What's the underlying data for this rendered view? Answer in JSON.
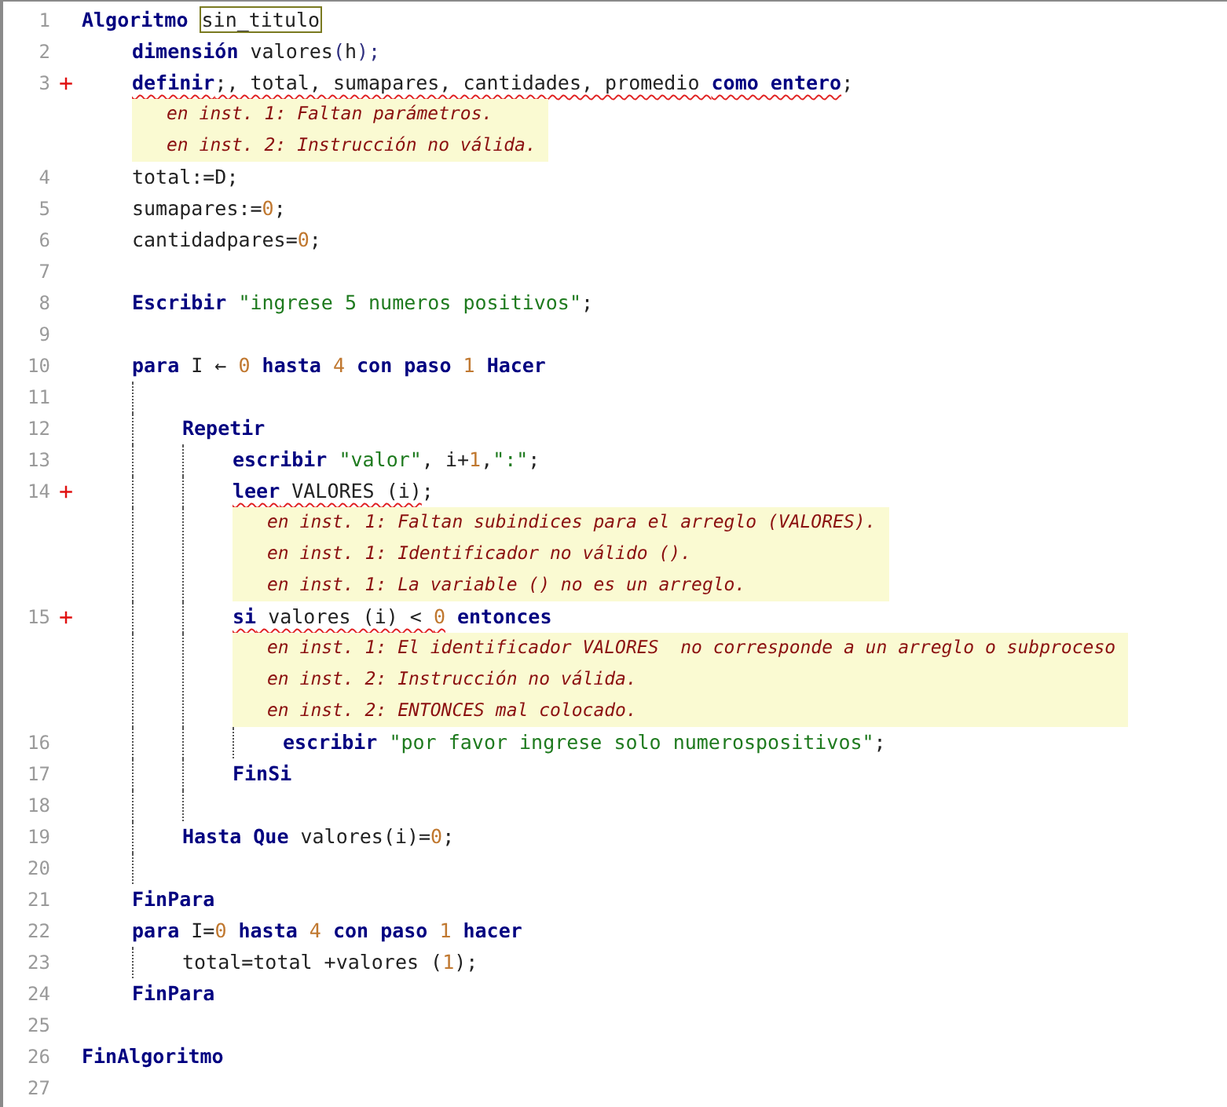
{
  "editor": {
    "lines": [
      {
        "number": "1",
        "tokens": [
          {
            "text": "Algoritmo ",
            "kind": "kw"
          },
          {
            "text": "sin_titulo",
            "kind": "match"
          }
        ],
        "children": [
          {
            "number": "2",
            "tokens": [
              {
                "text": "dimensión",
                "kind": "kw"
              },
              {
                "text": " valores",
                "kind": "id"
              },
              {
                "text": "(",
                "kind": "op"
              },
              {
                "text": "h",
                "kind": "id"
              },
              {
                "text": ");",
                "kind": "op"
              }
            ]
          },
          {
            "number": "3",
            "marker": "+",
            "tokens": [
              {
                "kind": "error",
                "tokens": [
                  {
                    "text": "definir",
                    "kind": "kw"
                  },
                  {
                    "text": ";, total, sumapares, cantidades, promedio ",
                    "kind": "id"
                  },
                  {
                    "text": "como entero",
                    "kind": "kw"
                  }
                ]
              },
              {
                "text": ";",
                "kind": "id"
              }
            ],
            "messages": [
              "en inst. 1: Faltan parámetros.",
              "en inst. 2: Instrucción no válida."
            ]
          },
          {
            "number": "4",
            "tokens": [
              {
                "text": "total:=D;",
                "kind": "id"
              }
            ]
          },
          {
            "number": "5",
            "tokens": [
              {
                "text": "sumapares:=",
                "kind": "id"
              },
              {
                "text": "0",
                "kind": "num"
              },
              {
                "text": ";",
                "kind": "id"
              }
            ]
          },
          {
            "number": "6",
            "tokens": [
              {
                "text": "cantidadpares=",
                "kind": "id"
              },
              {
                "text": "0",
                "kind": "num"
              },
              {
                "text": ";",
                "kind": "id"
              }
            ]
          },
          {
            "number": "7"
          },
          {
            "number": "8",
            "tokens": [
              {
                "text": "Escribir ",
                "kind": "kw"
              },
              {
                "text": "\"ingrese 5 numeros positivos\"",
                "kind": "str"
              },
              {
                "text": ";",
                "kind": "id"
              }
            ]
          },
          {
            "number": "9"
          },
          {
            "number": "10",
            "tokens": [
              {
                "text": "para",
                "kind": "kw"
              },
              {
                "text": " I ← ",
                "kind": "id"
              },
              {
                "text": "0",
                "kind": "num"
              },
              {
                "text": " hasta ",
                "kind": "kw"
              },
              {
                "text": "4",
                "kind": "num"
              },
              {
                "text": " con paso ",
                "kind": "kw"
              },
              {
                "text": "1",
                "kind": "num"
              },
              {
                "text": " Hacer",
                "kind": "kw"
              }
            ],
            "children": [
              {
                "number": "11"
              },
              {
                "number": "12",
                "tokens": [
                  {
                    "text": "Repetir",
                    "kind": "kw"
                  }
                ],
                "children": [
                  {
                    "number": "13",
                    "tokens": [
                      {
                        "text": "escribir ",
                        "kind": "kw"
                      },
                      {
                        "text": "\"valor\"",
                        "kind": "str"
                      },
                      {
                        "text": ", i+",
                        "kind": "id"
                      },
                      {
                        "text": "1",
                        "kind": "num"
                      },
                      {
                        "text": ",",
                        "kind": "id"
                      },
                      {
                        "text": "\":\"",
                        "kind": "str"
                      },
                      {
                        "text": ";",
                        "kind": "id"
                      }
                    ]
                  },
                  {
                    "number": "14",
                    "marker": "+",
                    "tokens": [
                      {
                        "kind": "error",
                        "tokens": [
                          {
                            "text": "leer",
                            "kind": "kw"
                          },
                          {
                            "text": " VALORES (i)",
                            "kind": "id"
                          }
                        ]
                      },
                      {
                        "text": ";",
                        "kind": "id"
                      }
                    ],
                    "messages": [
                      "en inst. 1: Faltan subindices para el arreglo (VALORES).",
                      "en inst. 1: Identificador no válido ().",
                      "en inst. 1: La variable () no es un arreglo."
                    ]
                  },
                  {
                    "number": "15",
                    "marker": "+",
                    "tokens": [
                      {
                        "kind": "error",
                        "tokens": [
                          {
                            "text": "si",
                            "kind": "kw"
                          },
                          {
                            "text": " valores (i) < ",
                            "kind": "id"
                          },
                          {
                            "text": "0",
                            "kind": "num"
                          }
                        ]
                      },
                      {
                        "text": " entonces",
                        "kind": "kw"
                      }
                    ],
                    "messages": [
                      "en inst. 1: El identificador VALORES  no corresponde a un arreglo o subproceso",
                      "en inst. 2: Instrucción no válida.",
                      "en inst. 2: ENTONCES mal colocado."
                    ],
                    "children": [
                      {
                        "number": "16",
                        "tokens": [
                          {
                            "text": "escribir ",
                            "kind": "kw"
                          },
                          {
                            "text": "\"por favor ingrese solo numerospositivos\"",
                            "kind": "str"
                          },
                          {
                            "text": ";",
                            "kind": "id"
                          }
                        ]
                      }
                    ]
                  },
                  {
                    "number": "17",
                    "tokens": [
                      {
                        "text": "FinSi",
                        "kind": "kw"
                      }
                    ]
                  },
                  {
                    "number": "18"
                  }
                ]
              },
              {
                "number": "19",
                "tokens": [
                  {
                    "text": "Hasta Que",
                    "kind": "kw"
                  },
                  {
                    "text": " valores(i)=",
                    "kind": "id"
                  },
                  {
                    "text": "0",
                    "kind": "num"
                  },
                  {
                    "text": ";",
                    "kind": "id"
                  }
                ]
              },
              {
                "number": "20"
              }
            ]
          },
          {
            "number": "21",
            "tokens": [
              {
                "text": "FinPara",
                "kind": "kw"
              }
            ]
          },
          {
            "number": "22",
            "tokens": [
              {
                "text": "para",
                "kind": "kw"
              },
              {
                "text": " I=",
                "kind": "id"
              },
              {
                "text": "0",
                "kind": "num"
              },
              {
                "text": " hasta ",
                "kind": "kw"
              },
              {
                "text": "4",
                "kind": "num"
              },
              {
                "text": " con paso ",
                "kind": "kw"
              },
              {
                "text": "1",
                "kind": "num"
              },
              {
                "text": " hacer",
                "kind": "kw"
              }
            ],
            "children": [
              {
                "number": "23",
                "tokens": [
                  {
                    "text": "total=total +valores (",
                    "kind": "id"
                  },
                  {
                    "text": "1",
                    "kind": "num"
                  },
                  {
                    "text": ");",
                    "kind": "id"
                  }
                ]
              }
            ]
          },
          {
            "number": "24",
            "tokens": [
              {
                "text": "FinPara",
                "kind": "kw"
              }
            ]
          },
          {
            "number": "25"
          }
        ]
      },
      {
        "number": "26",
        "tokens": [
          {
            "text": "FinAlgoritmo",
            "kind": "kw"
          }
        ]
      },
      {
        "number": "27"
      }
    ]
  }
}
